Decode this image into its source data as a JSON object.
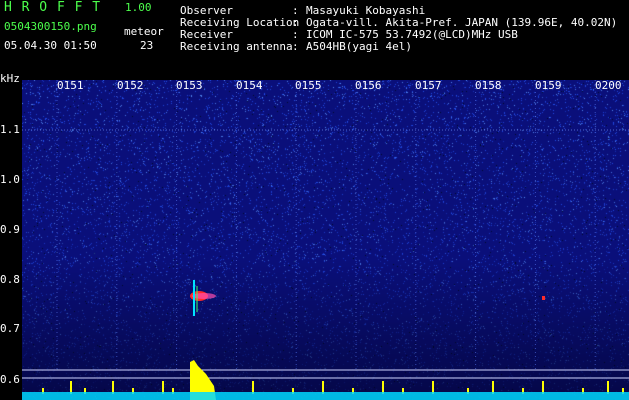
{
  "app": {
    "title": "H R O F F T",
    "version": "1.00",
    "filename": "0504300150.png",
    "timestamp": "05.04.30 01:50",
    "meteor_label": "meteor",
    "meteor_count": "23"
  },
  "info": {
    "rows": [
      {
        "label": "Observer",
        "sep": ":",
        "value": "Masayuki Kobayashi"
      },
      {
        "label": "Receiving Location",
        "sep": ":",
        "value": "Ogata-vill. Akita-Pref. JAPAN (139.96E, 40.02N)"
      },
      {
        "label": "Receiver",
        "sep": ":",
        "value": "ICOM IC-575 53.7492(@LCD)MHz USB"
      },
      {
        "label": "Receiving antenna",
        "sep": ":",
        "value": "A504HB(yagi 4el)"
      }
    ]
  },
  "axis": {
    "y_unit": "kHz",
    "freq_ticks": [
      "1.1",
      "1.0",
      "0.9",
      "0.8",
      "0.7",
      "0.6"
    ],
    "time_ticks": [
      "0151",
      "0152",
      "0153",
      "0154",
      "0155",
      "0156",
      "0157",
      "0158",
      "0159",
      "0200"
    ]
  },
  "colors": {
    "background": "#000000",
    "spectrum_base": "#0a0f7a",
    "noise_speck": "#3a6bff",
    "meteor_red": "#ff2a2a",
    "meteor_pink": "#ff4fb0",
    "meteor_cyan": "#00e5ff",
    "yellow": "#ffff00",
    "text_green": "#4cff4c",
    "grid_line": "#cfd3ff"
  }
}
